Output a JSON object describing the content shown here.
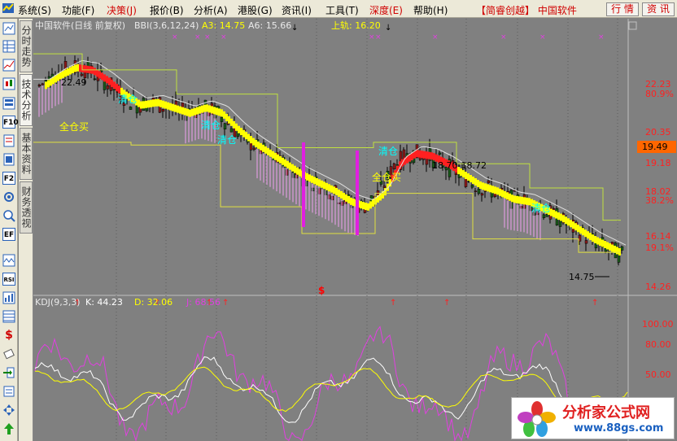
{
  "menu": {
    "items": [
      {
        "label": "系统(S)",
        "red": false
      },
      {
        "label": "功能(F)",
        "red": false
      },
      {
        "label": "决策(J)",
        "red": true
      },
      {
        "label": "报价(B)",
        "red": false
      },
      {
        "label": "分析(A)",
        "red": false
      },
      {
        "label": "港股(G)",
        "red": false
      },
      {
        "label": "资讯(I)",
        "red": false
      },
      {
        "label": "工具(T)",
        "red": false
      },
      {
        "label": "深度(E)",
        "red": true
      },
      {
        "label": "帮助(H)",
        "red": false
      }
    ],
    "brand": "【简睿创越】 中国软件",
    "quote_button": "行 情",
    "info_button": "资 讯"
  },
  "toolbar": {
    "icons": [
      "chart-icon",
      "table-icon",
      "line-chart-icon",
      "candle-icon",
      "grid-icon",
      "f10-icon",
      "finance-icon",
      "f2-icon",
      "search-icon",
      "ef-icon",
      "wave-icon",
      "rsi-icon",
      "indicator-icon",
      "coin-icon",
      "eraser-icon",
      "import-icon",
      "move-icon",
      "arrow-up-icon"
    ],
    "f10_label": "F10",
    "f2_label": "F2",
    "ef_label": "EF",
    "rsi_label": "RSI"
  },
  "side_tabs": [
    "分时走势",
    "技术分析",
    "基本资料",
    "财务透视"
  ],
  "main_panel": {
    "stock_name": "中国软件(日线 前复权)",
    "indicator": "BBI(3,6,12,24)",
    "a3": "A3: 14.75",
    "a6": "A6: 15.66",
    "upper_track": "上轨: 16.20",
    "signals": [
      {
        "text": "清仓",
        "color": "#00ffff"
      },
      {
        "text": "全仓买",
        "color": "#ffff00"
      },
      {
        "text": "清仓",
        "color": "#00ffff"
      },
      {
        "text": "清仓",
        "color": "#00ffff"
      },
      {
        "text": "全仓买",
        "color": "#ffff00"
      },
      {
        "text": "清仓",
        "color": "#00ffff"
      },
      {
        "text": "清仓",
        "color": "#00ffff"
      }
    ],
    "annotations": {
      "high": "22.49",
      "range": "18.70-18.72",
      "low": "14.75",
      "dollar": "$"
    },
    "y_axis": [
      "22.23",
      "80.9%",
      "20.35",
      "19.49",
      "19.18",
      "18.02",
      "38.2%",
      "16.14",
      "19.1%",
      "14.26"
    ],
    "current_price": "19.49"
  },
  "kdj_panel": {
    "title": "KDJ(9,3,3)",
    "k": "K: 44.23",
    "d": "D: 32.06",
    "j": "J: 68.56",
    "y_axis": [
      "100.00",
      "80.00",
      "50.00"
    ],
    "colors": {
      "k": "#ffffff",
      "d": "#ffff00",
      "j": "#e040e0"
    }
  },
  "watermark": {
    "title": "分析家公式网",
    "url": "www.88gs.com"
  },
  "chart_data": {
    "type": "line",
    "y_ticks": [
      22.23,
      20.35,
      19.18,
      18.02,
      16.14,
      14.26
    ],
    "ylim": [
      14.0,
      23.4
    ],
    "price_path": [
      21.5,
      21.9,
      22.2,
      22.1,
      21.7,
      21.2,
      20.8,
      20.9,
      20.7,
      20.5,
      20.7,
      20.5,
      19.9,
      19.4,
      19.0,
      18.6,
      18.2,
      17.9,
      17.6,
      17.2,
      17.0,
      17.5,
      18.6,
      19.0,
      18.9,
      18.6,
      18.2,
      17.8,
      17.6,
      17.3,
      17.2,
      16.9,
      16.6,
      16.2,
      15.8,
      15.5,
      15.2
    ]
  }
}
